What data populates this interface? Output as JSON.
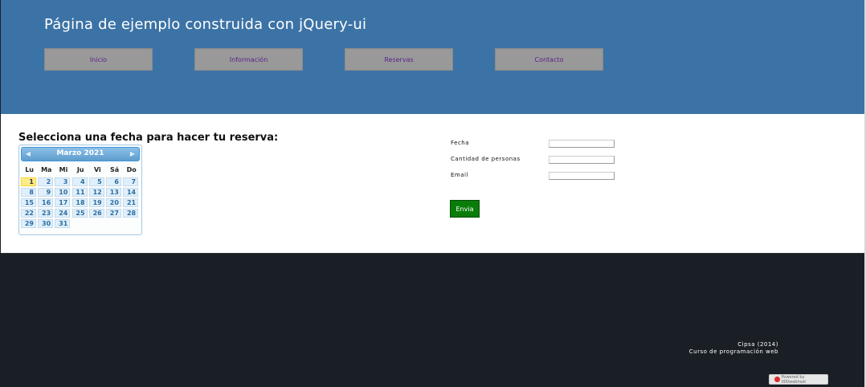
{
  "header": {
    "title": "Página de ejemplo construida con jQuery-ui",
    "nav": [
      {
        "label": "Inicio"
      },
      {
        "label": "Información"
      },
      {
        "label": "Reservas"
      },
      {
        "label": "Contacto"
      }
    ]
  },
  "main": {
    "section_title": "Selecciona una fecha para hacer tu reserva:",
    "datepicker": {
      "month_label": "Marzo 2021",
      "prev_icon": "chevron-left-icon",
      "next_icon": "chevron-right-icon",
      "weekdays": [
        "Lu",
        "Ma",
        "Mi",
        "Ju",
        "Vi",
        "Sá",
        "Do"
      ],
      "weeks": [
        [
          "1",
          "2",
          "3",
          "4",
          "5",
          "6",
          "7"
        ],
        [
          "8",
          "9",
          "10",
          "11",
          "12",
          "13",
          "14"
        ],
        [
          "15",
          "16",
          "17",
          "18",
          "19",
          "20",
          "21"
        ],
        [
          "22",
          "23",
          "24",
          "25",
          "26",
          "27",
          "28"
        ],
        [
          "29",
          "30",
          "31",
          "",
          "",
          "",
          ""
        ]
      ],
      "highlighted_day": "1"
    },
    "form": {
      "fecha_label": "Fecha",
      "fecha_value": "",
      "personas_label": "Cantidad de personas",
      "personas_value": "",
      "email_label": "Email",
      "email_value": "",
      "submit_label": "Envia"
    }
  },
  "footer": {
    "line1": "Cipsa (2014)",
    "line2": "Curso de programación web",
    "badge": "Powered by 000webhost"
  },
  "colors": {
    "header_bg": "#3c73a6",
    "nav_bg": "#999999",
    "nav_text": "#5a1f8c",
    "submit_bg": "#0a7c0a",
    "footer_bg": "#1a1f25"
  }
}
